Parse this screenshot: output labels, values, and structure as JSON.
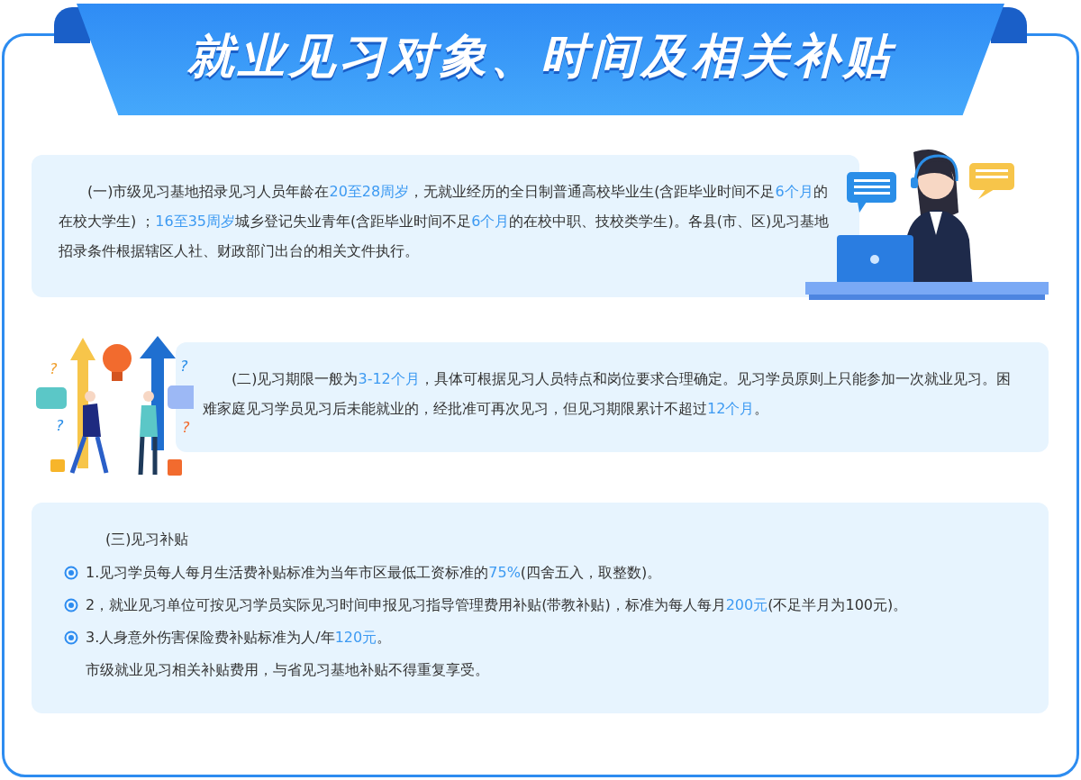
{
  "title": "就业见习对象、时间及相关补贴",
  "question_marks": [
    "?",
    "?",
    "?",
    "?"
  ],
  "sections": [
    {
      "kind": "paragraph",
      "segments": [
        {
          "text": "(一)市级见习基地招录见习人员年龄在",
          "highlight": false
        },
        {
          "text": "20至28周岁",
          "highlight": true
        },
        {
          "text": "，无就业经历的全日制普通高校毕业生(含距毕业时间不足",
          "highlight": false
        },
        {
          "text": "6个月",
          "highlight": true
        },
        {
          "text": "的在校大学生) ；",
          "highlight": false
        },
        {
          "text": "16至35周岁",
          "highlight": true
        },
        {
          "text": "城乡登记失业青年(含距毕业时间不足",
          "highlight": false
        },
        {
          "text": "6个月",
          "highlight": true
        },
        {
          "text": "的在校中职、技校类学生)。各县(市、区)见习基地招录条件根据辖区人社、财政部门出台的相关文件执行。",
          "highlight": false
        }
      ]
    },
    {
      "kind": "paragraph",
      "segments": [
        {
          "text": "(二)见习期限一般为",
          "highlight": false
        },
        {
          "text": "3-12个月",
          "highlight": true
        },
        {
          "text": "，具体可根据见习人员特点和岗位要求合理确定。见习学员原则上只能参加一次就业见习。困难家庭见习学员见习后未能就业的，经批准可再次见习，但见习期限累计不超过",
          "highlight": false
        },
        {
          "text": "12个月",
          "highlight": true
        },
        {
          "text": "。",
          "highlight": false
        }
      ]
    },
    {
      "kind": "list",
      "heading": "(三)见习补贴",
      "items": [
        {
          "bullet": true,
          "segments": [
            {
              "text": "1.见习学员每人每月生活费补贴标准为当年市区最低工资标准的",
              "highlight": false
            },
            {
              "text": "75%",
              "highlight": true
            },
            {
              "text": "(四舍五入，取整数)。",
              "highlight": false
            }
          ]
        },
        {
          "bullet": true,
          "segments": [
            {
              "text": "2，就业见习单位可按见习学员实际见习时间申报见习指导管理费用补贴(带教补贴)，标准为每人每月",
              "highlight": false
            },
            {
              "text": "200元",
              "highlight": true
            },
            {
              "text": "(不足半月为100元)。",
              "highlight": false
            }
          ]
        },
        {
          "bullet": true,
          "segments": [
            {
              "text": "3.人身意外伤害保险费补贴标准为人/年",
              "highlight": false
            },
            {
              "text": "120元",
              "highlight": true
            },
            {
              "text": "。",
              "highlight": false
            }
          ]
        },
        {
          "bullet": false,
          "segments": [
            {
              "text": "市级就业见习相关补贴费用，与省见习基地补贴不得重复享受。",
              "highlight": false
            }
          ]
        }
      ]
    }
  ]
}
